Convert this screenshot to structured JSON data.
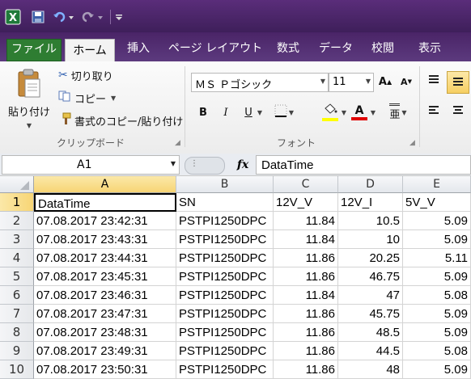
{
  "quick_access": {
    "app_icon": "excel-icon",
    "save_icon": "save-icon",
    "undo_icon": "undo-icon",
    "redo_icon": "redo-icon",
    "customize_icon": "customize-icon"
  },
  "tabs": [
    {
      "label": "ファイル"
    },
    {
      "label": "ホーム"
    },
    {
      "label": "挿入"
    },
    {
      "label": "ページ レイアウト"
    },
    {
      "label": "数式"
    },
    {
      "label": "データ"
    },
    {
      "label": "校閲"
    },
    {
      "label": "表示"
    }
  ],
  "clipboard": {
    "paste_label": "貼り付け",
    "cut_label": "切り取り",
    "copy_label": "コピー",
    "format_painter_label": "書式のコピー/貼り付け",
    "group_label": "クリップボード"
  },
  "font": {
    "name": "ＭＳ Ｐゴシック",
    "size": "11",
    "bold": "B",
    "italic": "I",
    "underline": "U",
    "group_label": "フォント",
    "grow_label": "A",
    "shrink_label": "A",
    "phonetic_label": "亜"
  },
  "formula_bar": {
    "name_box": "A1",
    "fx_label": "fx",
    "value": "DataTime"
  },
  "sheet": {
    "columns": [
      "A",
      "B",
      "C",
      "D",
      "E"
    ],
    "rows": [
      {
        "num": "1",
        "cells": [
          "DataTime",
          "SN",
          "12V_V",
          "12V_I",
          "5V_V"
        ]
      },
      {
        "num": "2",
        "cells": [
          "07.08.2017 23:42:31",
          "PSTPI1250DPC",
          "11.84",
          "10.5",
          "5.09"
        ]
      },
      {
        "num": "3",
        "cells": [
          "07.08.2017 23:43:31",
          "PSTPI1250DPC",
          "11.84",
          "10",
          "5.09"
        ]
      },
      {
        "num": "4",
        "cells": [
          "07.08.2017 23:44:31",
          "PSTPI1250DPC",
          "11.86",
          "20.25",
          "5.11"
        ]
      },
      {
        "num": "5",
        "cells": [
          "07.08.2017 23:45:31",
          "PSTPI1250DPC",
          "11.86",
          "46.75",
          "5.09"
        ]
      },
      {
        "num": "6",
        "cells": [
          "07.08.2017 23:46:31",
          "PSTPI1250DPC",
          "11.84",
          "47",
          "5.08"
        ]
      },
      {
        "num": "7",
        "cells": [
          "07.08.2017 23:47:31",
          "PSTPI1250DPC",
          "11.86",
          "45.75",
          "5.09"
        ]
      },
      {
        "num": "8",
        "cells": [
          "07.08.2017 23:48:31",
          "PSTPI1250DPC",
          "11.86",
          "48.5",
          "5.09"
        ]
      },
      {
        "num": "9",
        "cells": [
          "07.08.2017 23:49:31",
          "PSTPI1250DPC",
          "11.86",
          "44.5",
          "5.08"
        ]
      },
      {
        "num": "10",
        "cells": [
          "07.08.2017 23:50:31",
          "PSTPI1250DPC",
          "11.86",
          "48",
          "5.09"
        ]
      }
    ]
  }
}
